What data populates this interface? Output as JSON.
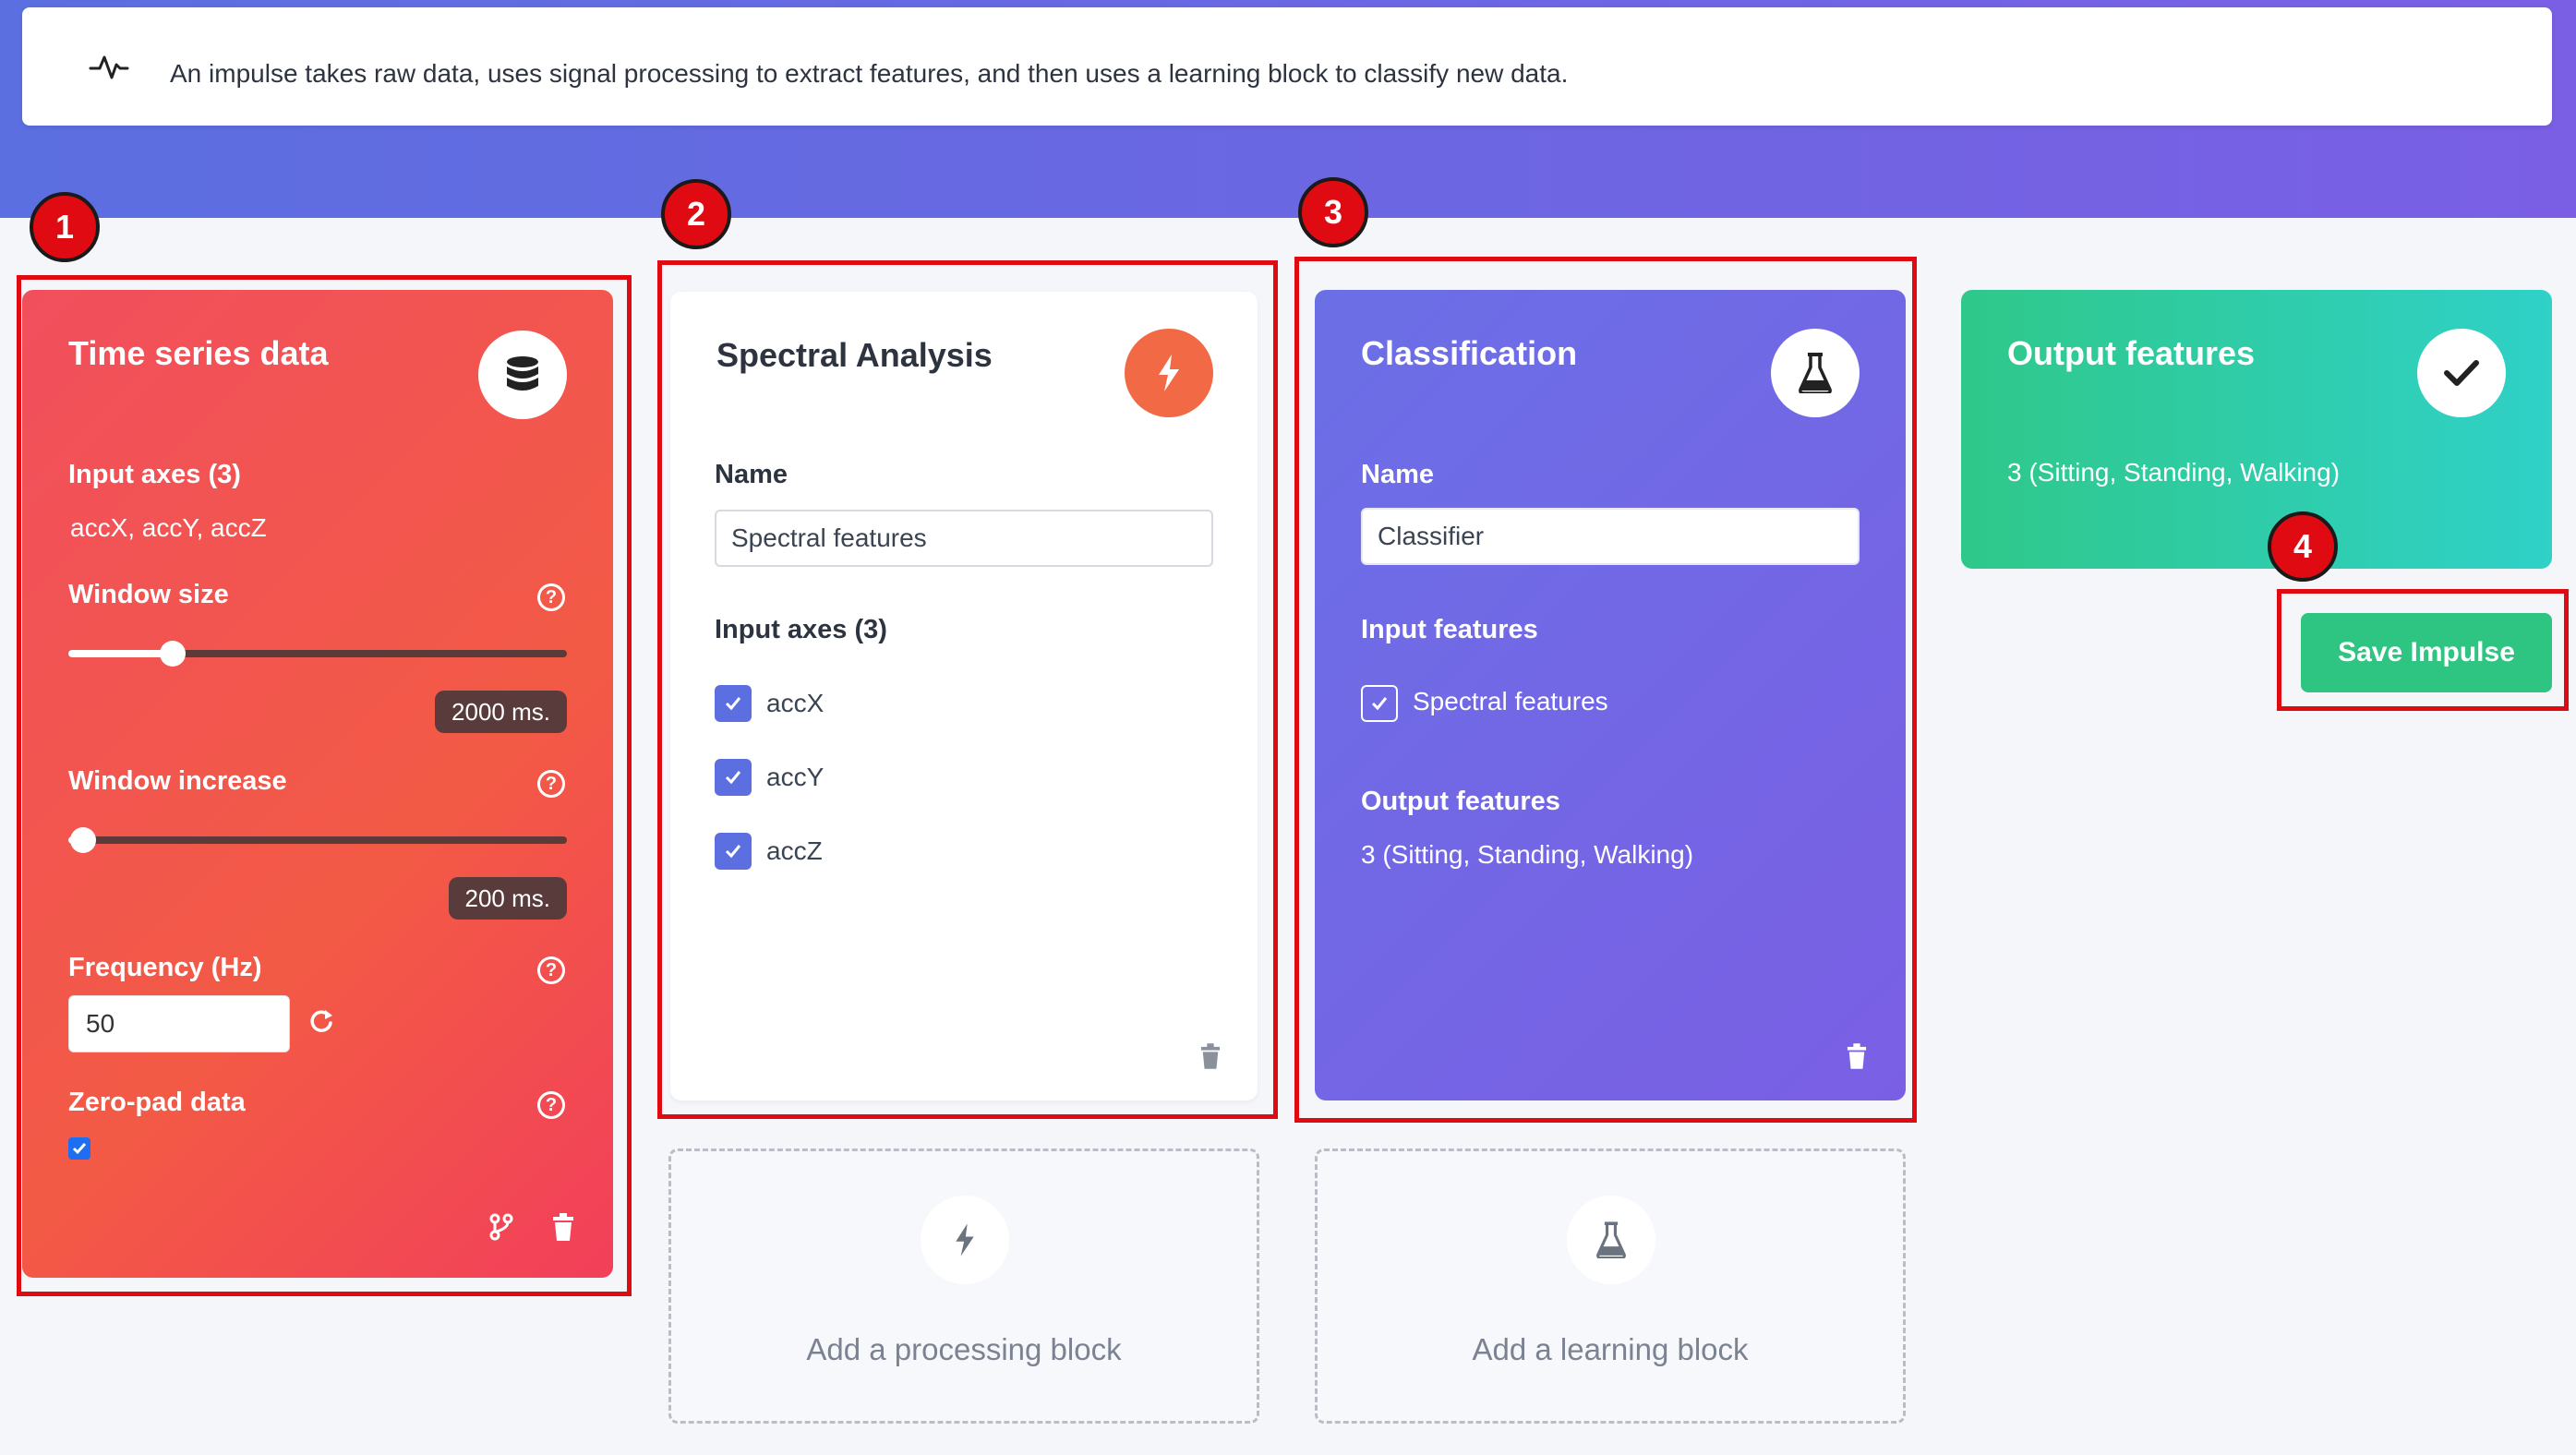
{
  "info": {
    "text": "An impulse takes raw data, uses signal processing to extract features, and then uses a learning block to classify new data."
  },
  "time_series": {
    "title": "Time series data",
    "input_axes_label": "Input axes (3)",
    "input_axes_value": "accX, accY, accZ",
    "window_size_label": "Window size",
    "window_size_value": "2000 ms.",
    "window_size_fraction": 0.21,
    "window_increase_label": "Window increase",
    "window_increase_value": "200 ms.",
    "window_increase_fraction": 0.03,
    "frequency_label": "Frequency (Hz)",
    "frequency_value": "50",
    "zeropad_label": "Zero-pad data",
    "zeropad_checked": true,
    "icon": "database-icon"
  },
  "spectral": {
    "title": "Spectral Analysis",
    "name_label": "Name",
    "name_value": "Spectral features",
    "input_axes_label": "Input axes (3)",
    "axes": [
      {
        "label": "accX",
        "checked": true
      },
      {
        "label": "accY",
        "checked": true
      },
      {
        "label": "accZ",
        "checked": true
      }
    ],
    "icon": "lightning-icon"
  },
  "classification": {
    "title": "Classification",
    "name_label": "Name",
    "name_value": "Classifier",
    "input_features_label": "Input features",
    "input_feature": "Spectral features",
    "output_features_label": "Output features",
    "output_features_value": "3 (Sitting, Standing, Walking)",
    "icon": "flask-icon"
  },
  "output": {
    "title": "Output features",
    "value": "3 (Sitting, Standing, Walking)",
    "icon": "checkmark-icon"
  },
  "save_label": "Save Impulse",
  "add_processing_label": "Add a processing block",
  "add_learning_label": "Add a learning block",
  "badges": [
    "1",
    "2",
    "3",
    "4"
  ],
  "colors": {
    "time_series": "#f14f5d",
    "spectral_icon": "#f26a45",
    "classification": "#6b6fe6",
    "output": "#2fc88a",
    "save": "#2ec481",
    "highlight": "#e00b12"
  }
}
